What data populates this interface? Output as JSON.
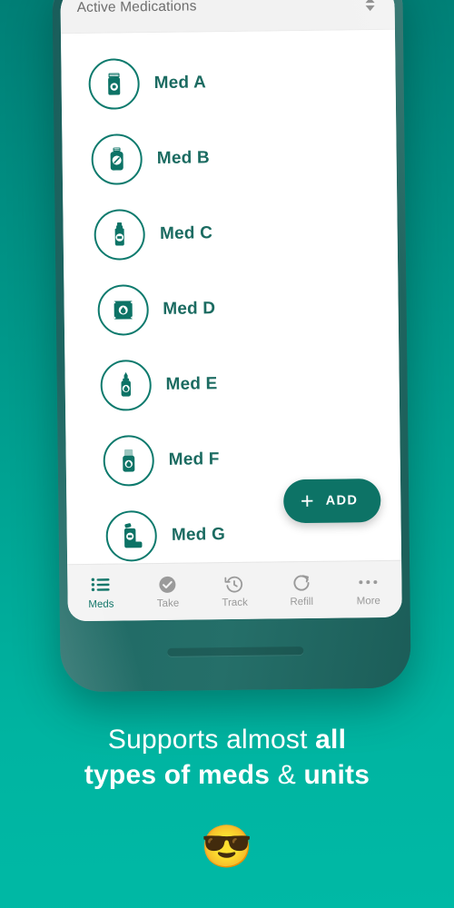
{
  "theme": {
    "bg_top": "#007f76",
    "bg_bottom": "#00b9a5",
    "accent": "#0d7366",
    "med_text": "#1b6b61",
    "nav_inactive": "#9a9a9a",
    "header_bg": "#f2f2f2"
  },
  "app": {
    "header": {
      "title": "Active Medications",
      "sort_icon": "sort-updown-icon"
    },
    "medications": [
      {
        "label": "Med A",
        "icon": "pill-box-icon"
      },
      {
        "label": "Med B",
        "icon": "pill-bottle-icon"
      },
      {
        "label": "Med C",
        "icon": "syrup-bottle-icon"
      },
      {
        "label": "Med D",
        "icon": "sachet-packet-icon"
      },
      {
        "label": "Med E",
        "icon": "dropper-bottle-icon"
      },
      {
        "label": "Med F",
        "icon": "pump-bottle-icon"
      },
      {
        "label": "Med G",
        "icon": "inhaler-icon"
      }
    ],
    "add_button": {
      "plus": "+",
      "label": "ADD"
    },
    "bottom_nav": [
      {
        "label": "Meds",
        "icon": "list-icon",
        "active": true
      },
      {
        "label": "Take",
        "icon": "check-circle-icon",
        "active": false
      },
      {
        "label": "Track",
        "icon": "history-clock-icon",
        "active": false
      },
      {
        "label": "Refill",
        "icon": "refresh-icon",
        "active": false
      },
      {
        "label": "More",
        "icon": "ellipsis-icon",
        "active": false
      }
    ]
  },
  "promo": {
    "line1_normal": "Supports almost ",
    "line1_bold": "all",
    "line2_bold_a": "types of meds",
    "line2_normal": " & ",
    "line2_bold_b": "units",
    "emoji": "😎"
  }
}
